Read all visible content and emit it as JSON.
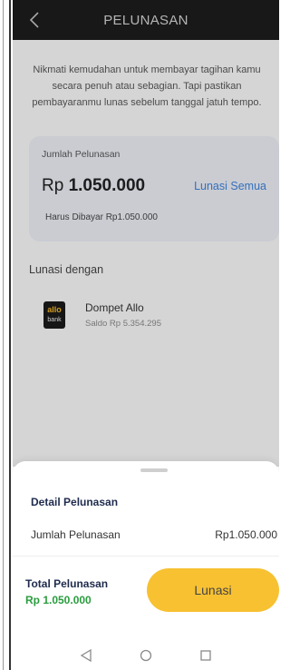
{
  "header": {
    "title": "PELUNASAN",
    "back_icon": "chevron-left-icon"
  },
  "intro_text": "Nikmati kemudahan untuk membayar tagihan kamu secara penuh atau sebagian. Tapi pastikan pembayaranmu lunas sebelum tanggal jatuh tempo.",
  "card": {
    "label": "Jumlah Pelunasan",
    "currency": "Rp",
    "amount": "1.050.000",
    "lunasi_semua": "Lunasi Semua",
    "harus_dibayar": "Harus Dibayar Rp1.050.000"
  },
  "lunasi_dengan": "Lunasi dengan",
  "wallet": {
    "logo_top": "allo",
    "logo_bottom": "bank",
    "name": "Dompet Allo",
    "saldo": "Saldo Rp 5.354.295"
  },
  "sheet": {
    "detail_title": "Detail Pelunasan",
    "row_label": "Jumlah Pelunasan",
    "row_value": "Rp1.050.000",
    "total_label": "Total Pelunasan",
    "total_value": "Rp 1.050.000",
    "button_label": "Lunasi"
  },
  "navbar": {
    "icons": [
      "back-triangle-icon",
      "home-circle-icon",
      "recents-square-icon"
    ]
  },
  "colors": {
    "accent_button": "#f7c132",
    "link": "#3d7fd6",
    "total_value": "#2a9c3e",
    "header_bg": "#1c1c1c"
  }
}
